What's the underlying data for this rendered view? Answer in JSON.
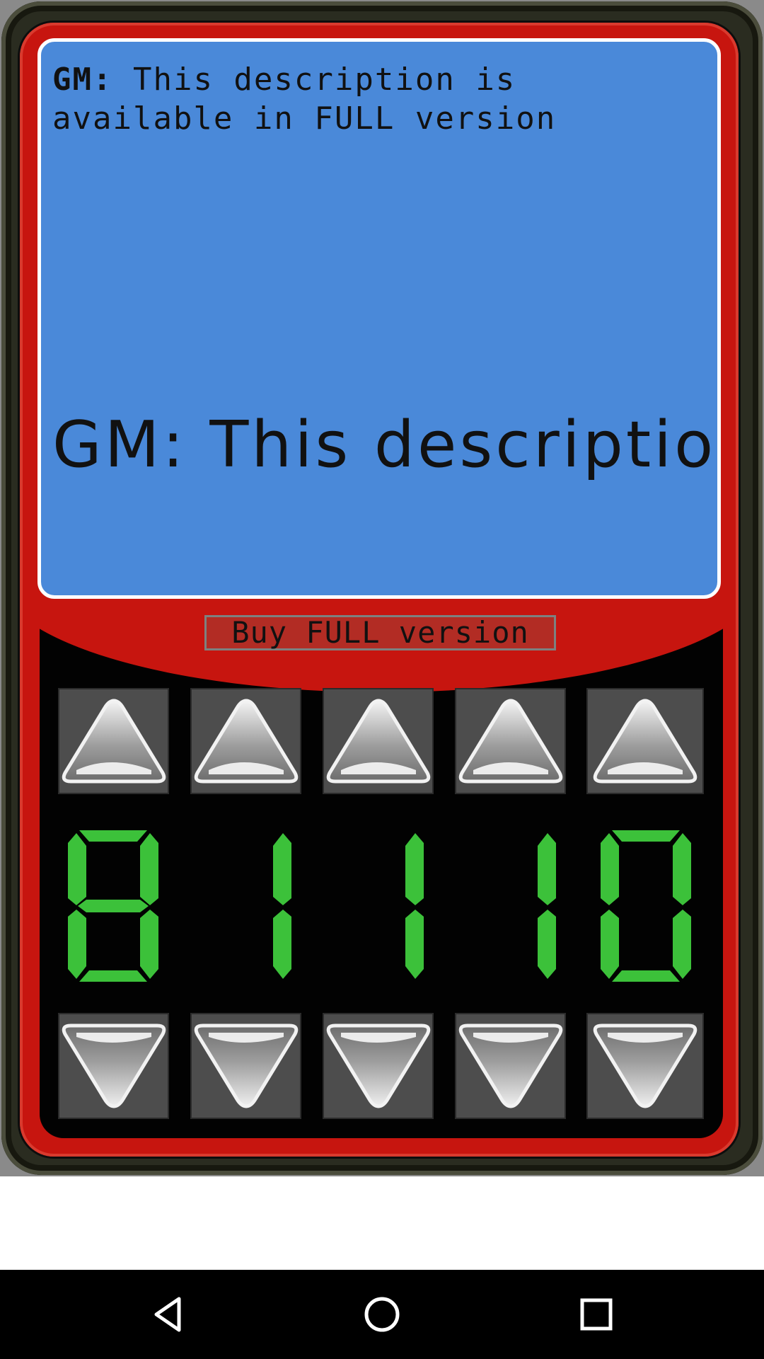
{
  "screen": {
    "label": "GM:",
    "description": "This description is available in FULL version",
    "scrolling_text": "GM: This description is available in FULL version"
  },
  "buy_button": {
    "label": "Buy FULL version"
  },
  "digits": [
    "8",
    "1",
    "1",
    "1",
    "0"
  ],
  "colors": {
    "screen": "#4a89d9",
    "body_red": "#c7150f",
    "digit_green": "#3cc13a",
    "button_gray": "#4d4d4d"
  },
  "icons": {
    "up_arrow": "triangle-up-icon",
    "down_arrow": "triangle-down-icon",
    "back": "back-icon",
    "home": "home-icon",
    "recents": "recents-icon"
  }
}
